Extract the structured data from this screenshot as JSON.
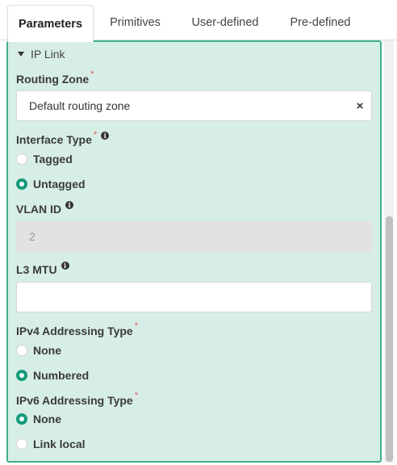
{
  "tabs": [
    {
      "label": "Parameters",
      "active": true
    },
    {
      "label": "Primitives"
    },
    {
      "label": "User-defined"
    },
    {
      "label": "Pre-defined"
    }
  ],
  "section": {
    "title": "IP Link",
    "expanded": true
  },
  "routing_zone": {
    "label": "Routing Zone",
    "required_mark": "*",
    "value": "Default routing zone",
    "clear_icon": "×"
  },
  "interface_type": {
    "label": "Interface Type",
    "required_mark": "*",
    "info_icon": "i",
    "options": [
      {
        "label": "Tagged",
        "checked": false
      },
      {
        "label": "Untagged",
        "checked": true
      }
    ]
  },
  "vlan_id": {
    "label": "VLAN ID",
    "info_icon": "i",
    "value": "2",
    "disabled": true
  },
  "l3_mtu": {
    "label": "L3 MTU",
    "info_icon": "i",
    "value": ""
  },
  "ipv4": {
    "label": "IPv4 Addressing Type",
    "required_mark": "*",
    "options": [
      {
        "label": "None",
        "checked": false
      },
      {
        "label": "Numbered",
        "checked": true
      }
    ]
  },
  "ipv6": {
    "label": "IPv6 Addressing Type",
    "required_mark": "*",
    "options": [
      {
        "label": "None",
        "checked": true
      },
      {
        "label": "Link local",
        "checked": false
      }
    ]
  },
  "colors": {
    "accent": "#14997a",
    "panel_bg": "#d7eee6",
    "panel_border": "#3fae8d",
    "required": "#d9534f"
  }
}
